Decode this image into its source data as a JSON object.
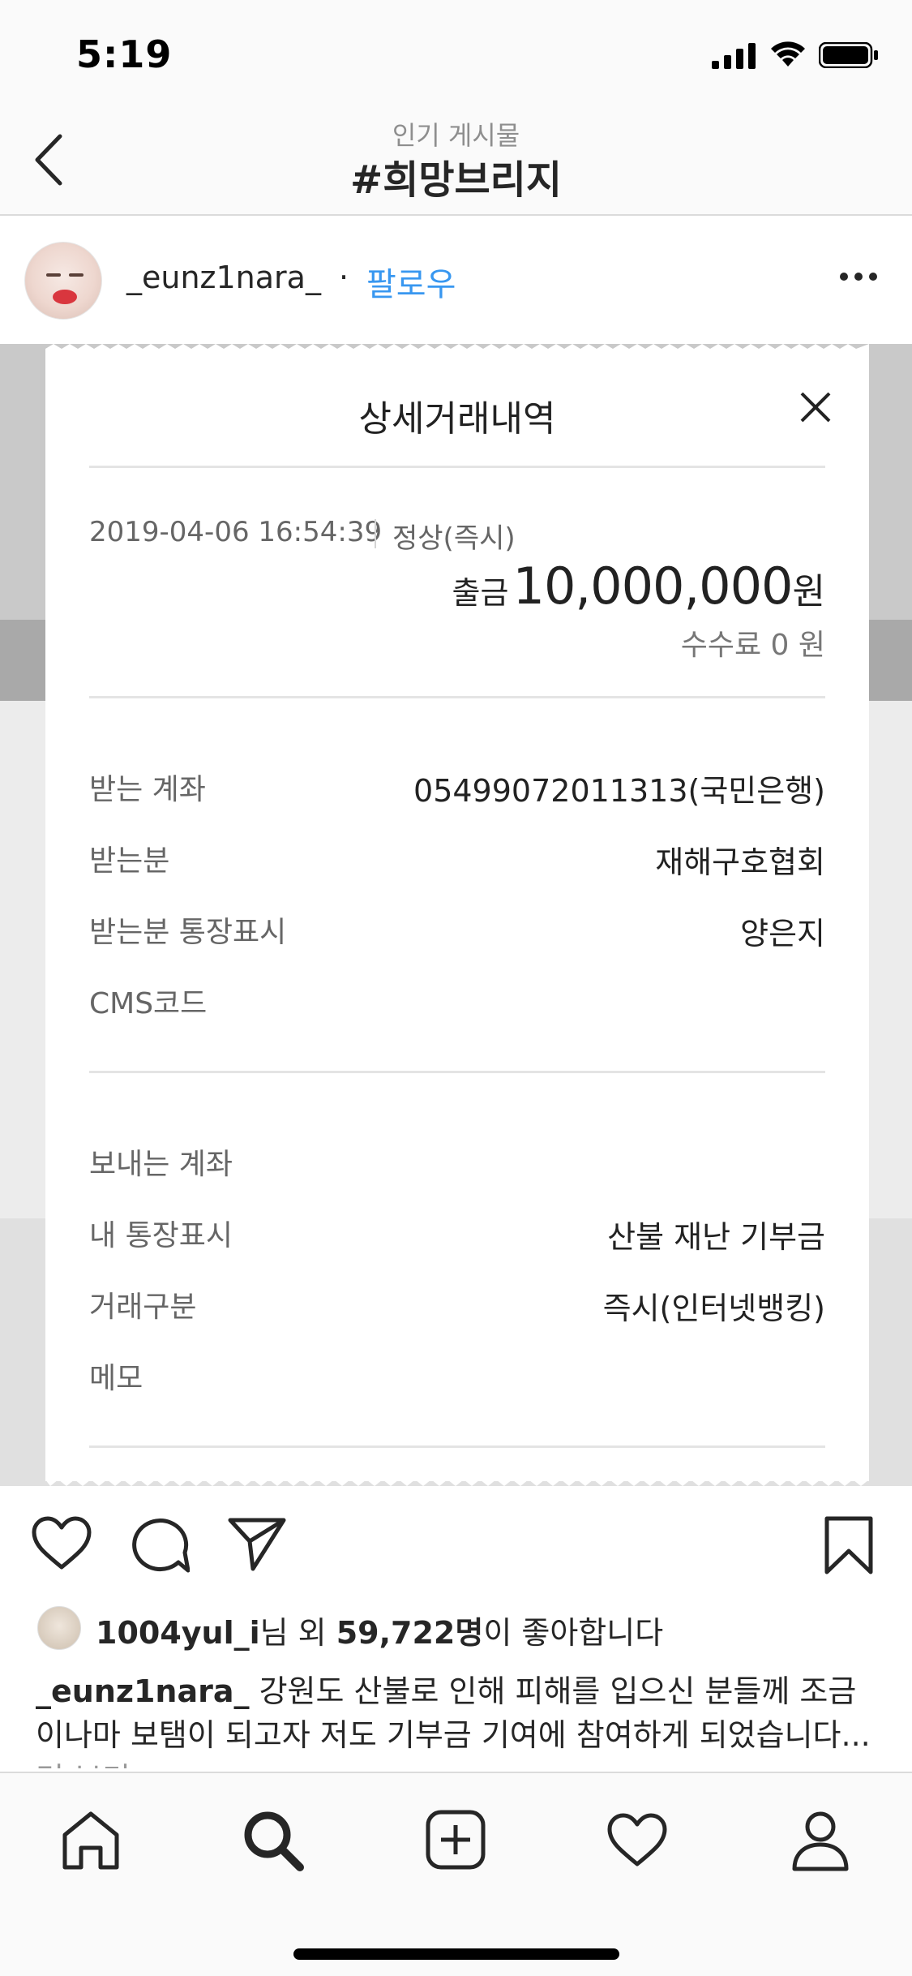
{
  "status_bar": {
    "time": "5:19"
  },
  "header": {
    "subtitle": "인기 게시물",
    "title": "#희망브리지"
  },
  "post": {
    "username": "_eunz1nara_",
    "separator": "·",
    "follow_label": "팔로우"
  },
  "receipt": {
    "title": "상세거래내역",
    "datetime": "2019-04-06 16:54:39",
    "status": "정상(즉시)",
    "type": "출금",
    "amount": "10,000,000",
    "currency": "원",
    "fee": "수수료 0 원",
    "rows_group1": [
      {
        "label": "받는 계좌",
        "value": "05499072011313(국민은행)"
      },
      {
        "label": "받는분",
        "value": "재해구호협회"
      },
      {
        "label": "받는분 통장표시",
        "value": "양은지"
      },
      {
        "label": "CMS코드",
        "value": ""
      }
    ],
    "rows_group2": [
      {
        "label": "보내는 계좌",
        "value": ""
      },
      {
        "label": "내 통장표시",
        "value": "산불 재난 기부금"
      },
      {
        "label": "거래구분",
        "value": "즉시(인터넷뱅킹)"
      },
      {
        "label": "메모",
        "value": ""
      }
    ]
  },
  "likes": {
    "user": "1004yul_i",
    "mid": "님 외 ",
    "count": "59,722명",
    "tail": "이 좋아합니다"
  },
  "caption": {
    "username": "_eunz1nara_",
    "text": " 강원도 산불로 인해 피해를 입으신 분들께 조금이나마 보탬이 되고자 저도 기부금 기여에 참여하게 되었습니다...",
    "more": " 더 보기"
  },
  "icons": {
    "back": "chevron-left-icon",
    "more": "more-horizontal-icon",
    "like": "heart-icon",
    "comment": "comment-icon",
    "share": "send-icon",
    "save": "bookmark-icon",
    "tabs": [
      "home-icon",
      "search-icon",
      "add-post-icon",
      "activity-heart-icon",
      "profile-icon"
    ]
  },
  "colors": {
    "link_blue": "#3897f0",
    "text_dark": "#262626",
    "muted": "#8e8e8e"
  }
}
